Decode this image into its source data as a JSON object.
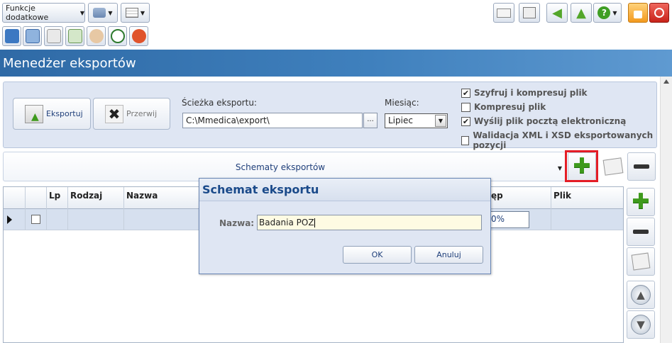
{
  "toolbar": {
    "functions_label": "Funkcje dodatkowe"
  },
  "page": {
    "title": "Menedżer eksportów"
  },
  "panel": {
    "export_label": "Eksportuj",
    "stop_label": "Przerwij",
    "path_label": "Ścieżka eksportu:",
    "path_value": "C:\\Mmedica\\export\\",
    "browse_label": "...",
    "month_label": "Miesiąc:",
    "month_value": "Lipiec",
    "options": [
      {
        "label": "Szyfruj i kompresuj plik",
        "checked": true
      },
      {
        "label": "Kompresuj plik",
        "checked": false
      },
      {
        "label": "Wyślij plik pocztą elektroniczną",
        "checked": true
      },
      {
        "label": "Walidacja XML i XSD eksportowanych pozycji",
        "checked": false
      }
    ]
  },
  "schemes": {
    "label": "Schematy eksportów"
  },
  "grid": {
    "columns": [
      "Lp",
      "Rodzaj",
      "Nazwa",
      "ęp",
      "Plik"
    ],
    "row_progress": "0%"
  },
  "dialog": {
    "title": "Schemat eksportu",
    "name_label": "Nazwa:",
    "name_value": "Badania POZ",
    "ok_label": "OK",
    "cancel_label": "Anuluj"
  },
  "colors": {
    "header_blue": "#2f6aa6",
    "highlight_red": "#e41d26",
    "add_green": "#3e9a1c"
  }
}
